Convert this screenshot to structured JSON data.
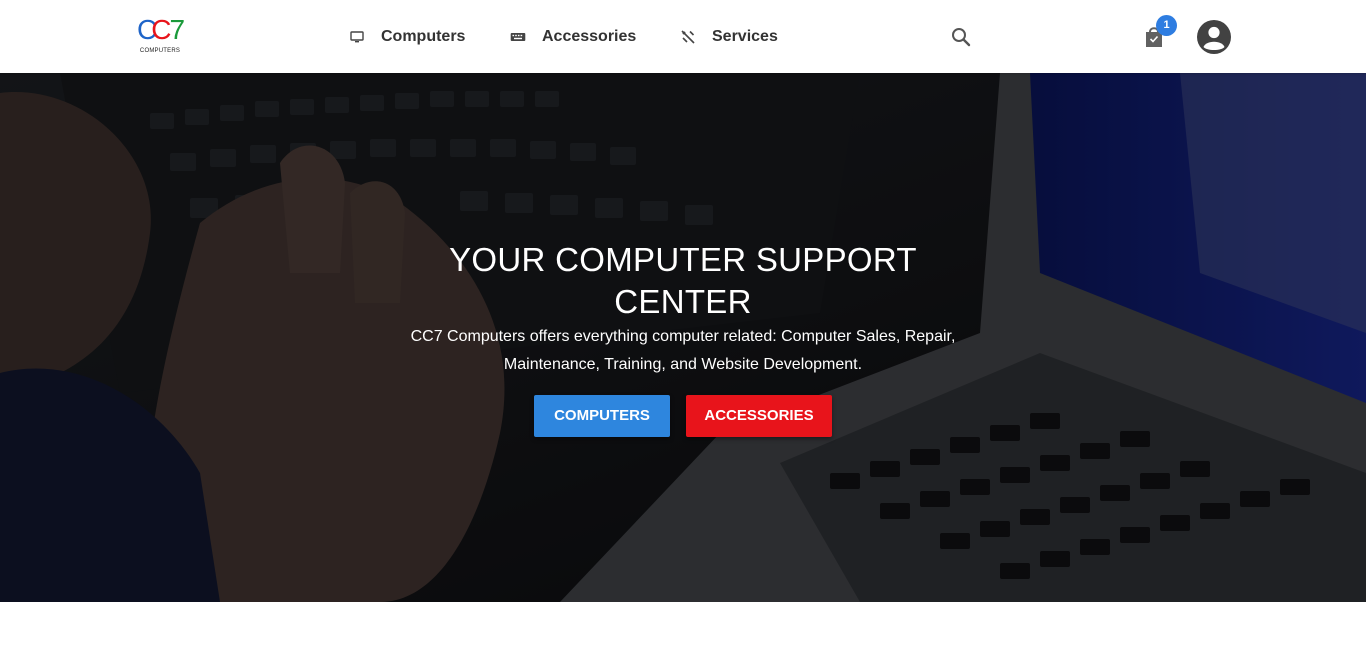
{
  "brand": {
    "logo_text": "CC7",
    "logo_subtext": "COMPUTERS",
    "colors": {
      "c1": "#1e64c8",
      "c2": "#e8141b",
      "seven": "#1a9a3a",
      "yellow": "#f2c200"
    }
  },
  "nav": {
    "items": [
      {
        "label": "Computers",
        "icon": "monitor-icon"
      },
      {
        "label": "Accessories",
        "icon": "keyboard-icon"
      },
      {
        "label": "Services",
        "icon": "tools-icon"
      }
    ]
  },
  "header": {
    "search_icon": "search-icon",
    "cart_icon": "shopping-bag-icon",
    "cart_count": "1",
    "account_icon": "account-circle-icon"
  },
  "hero": {
    "title": "YOUR COMPUTER SUPPORT CENTER",
    "subtitle": "CC7 Computers offers everything computer related: Computer Sales, Repair, Maintenance, Training, and Website Development.",
    "buttons": [
      {
        "label": "COMPUTERS",
        "color": "#2e86de"
      },
      {
        "label": "ACCESSORIES",
        "color": "#e8141b"
      }
    ]
  }
}
